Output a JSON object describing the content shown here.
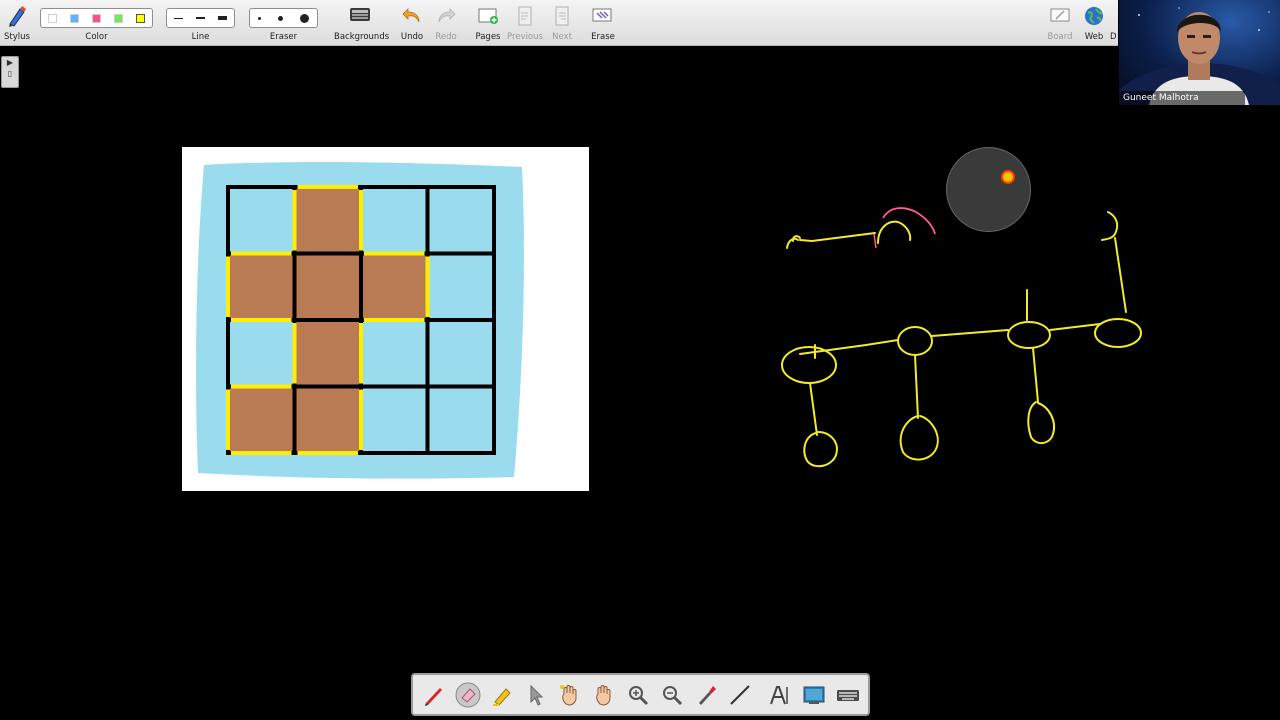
{
  "toolbar": {
    "stylus": "Stylus",
    "color": "Color",
    "line": "Line",
    "eraser": "Eraser",
    "backgrounds": "Backgrounds",
    "undo": "Undo",
    "redo": "Redo",
    "pages": "Pages",
    "previous": "Previous",
    "next": "Next",
    "erase": "Erase",
    "board": "Board",
    "web": "Web",
    "truncated": "D"
  },
  "colors": {
    "swatches": [
      "#ffffff",
      "#5ab4ff",
      "#ff4f8b",
      "#74e85a",
      "#ffff00"
    ],
    "drawing_stroke": "#f3ea2a",
    "accent_stroke": "#ff5c8a",
    "laser": "#ffc400"
  },
  "webcam": {
    "name": "Guneet Malhotra"
  },
  "grid": {
    "rows": 4,
    "cols": 4,
    "filled": [
      [
        0,
        1
      ],
      [
        1,
        0
      ],
      [
        1,
        1
      ],
      [
        1,
        2
      ],
      [
        2,
        1
      ],
      [
        3,
        0
      ],
      [
        3,
        1
      ]
    ],
    "fill_color": "#b97a54",
    "empty_color": "#9adcee",
    "outline_color": "#ffee00"
  },
  "palette": {
    "tools": [
      "pen-icon",
      "eraser-icon",
      "highlighter-icon",
      "pointer-icon",
      "magic-hand-icon",
      "hand-icon",
      "zoom-in-icon",
      "zoom-out-icon",
      "brush-icon",
      "line-icon",
      "text-icon",
      "screen-icon",
      "keyboard-icon"
    ]
  }
}
